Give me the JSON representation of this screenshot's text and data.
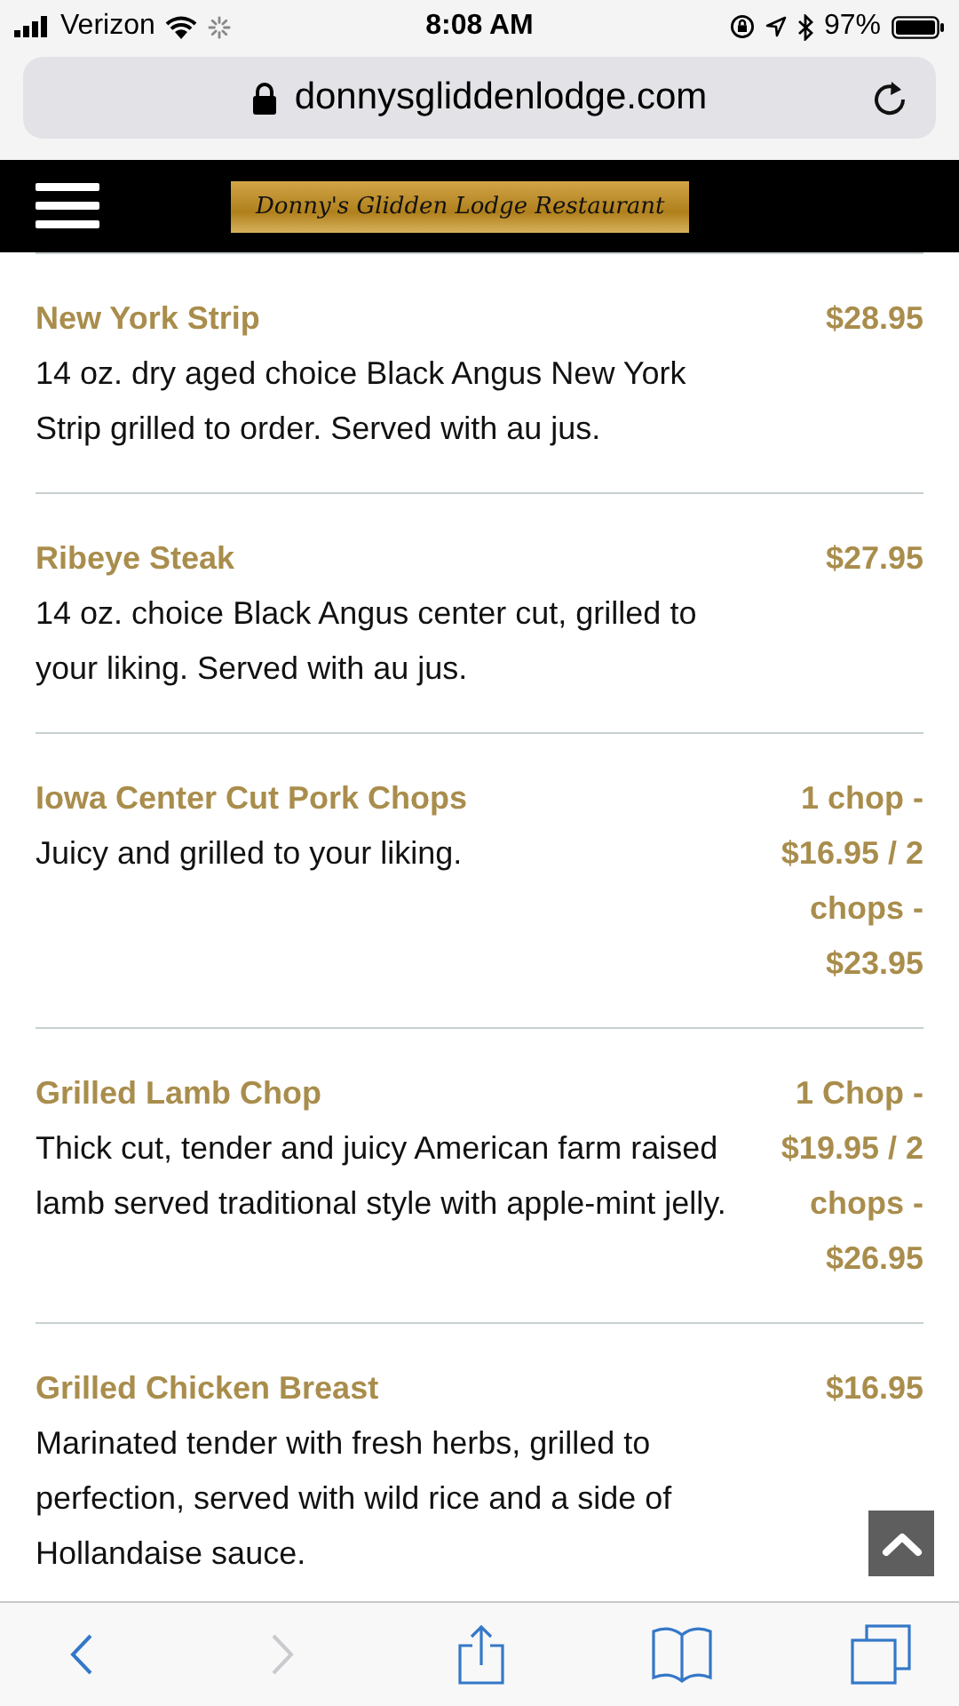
{
  "status_bar": {
    "carrier": "Verizon",
    "time": "8:08 AM",
    "battery": "97%"
  },
  "address_bar": {
    "url": "donnysgliddenlodge.com"
  },
  "header": {
    "logo": "Donny's Glidden Lodge Restaurant"
  },
  "menu_items": [
    {
      "name": "New York Strip",
      "description": "14 oz. dry aged choice Black Angus New York Strip grilled to order. Served with au jus.",
      "price": "$28.95"
    },
    {
      "name": "Ribeye Steak",
      "description": "14 oz. choice Black Angus center cut, grilled to your liking. Served with au jus.",
      "price": "$27.95"
    },
    {
      "name": "Iowa Center Cut Pork Chops",
      "description": "Juicy and grilled to your liking.",
      "price": "1 chop - $16.95 / 2 chops - $23.95"
    },
    {
      "name": "Grilled Lamb Chop",
      "description": "Thick cut, tender and juicy American farm raised lamb served traditional style with apple-mint jelly.",
      "price": "1 Chop - $19.95 / 2 chops - $26.95"
    },
    {
      "name": "Grilled Chicken Breast",
      "description": "Marinated tender with fresh herbs, grilled to perfection, served with wild rice and a side of Hollandaise sauce.",
      "price": "$16.95"
    }
  ],
  "toolbar": [
    {
      "kind": "back",
      "disabled": false
    },
    {
      "kind": "forward",
      "disabled": true
    },
    {
      "kind": "share",
      "disabled": false
    },
    {
      "kind": "bookmarks",
      "disabled": false
    },
    {
      "kind": "tabs",
      "disabled": false
    }
  ]
}
